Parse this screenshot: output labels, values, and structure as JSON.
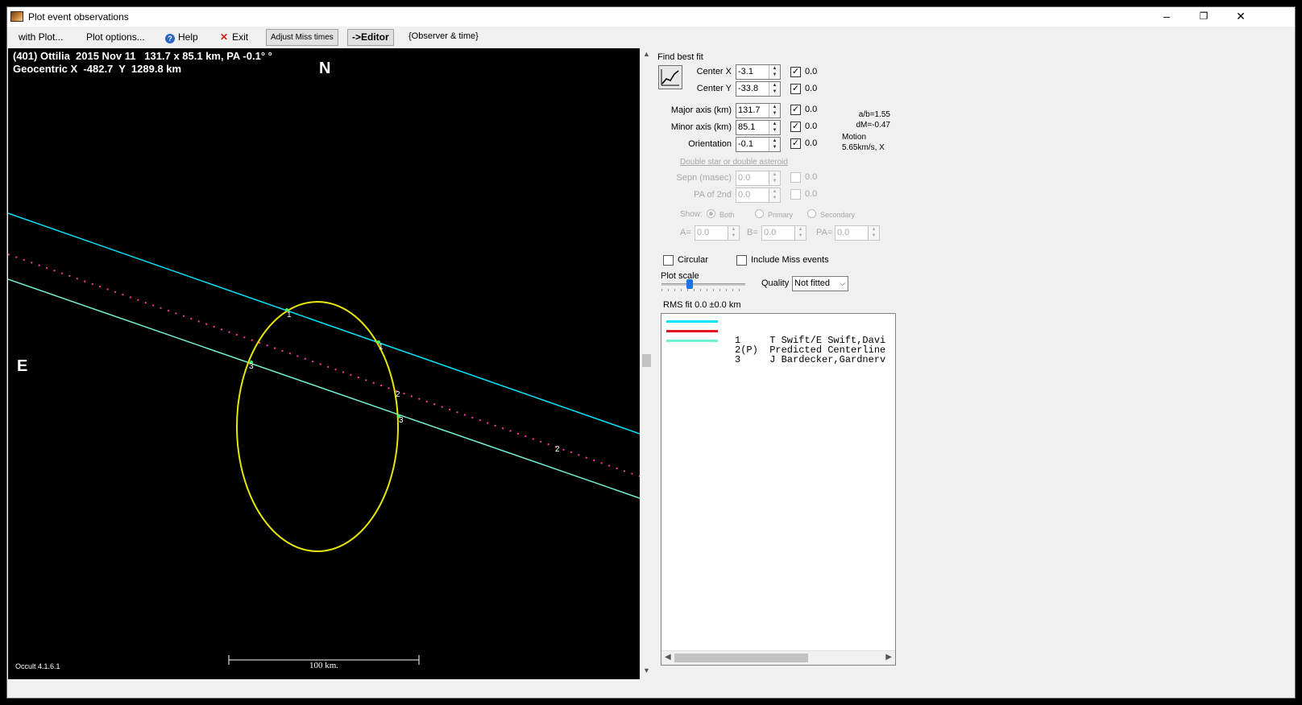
{
  "window": {
    "title": "Plot event observations",
    "min": "–",
    "restore": "❐",
    "close": "✕"
  },
  "menu": {
    "with_plot": "with Plot...",
    "plot_options": "Plot options...",
    "help": "Help",
    "exit": "Exit",
    "adjust_miss": "Adjust Miss times",
    "editor": "->Editor",
    "observer_time": "{Observer & time}"
  },
  "plot": {
    "header_line1": "(401) Ottilia  2015 Nov 11   131.7 x 85.1 km, PA -0.1° °",
    "header_line2": "Geocentric X  -482.7  Y  1289.8 km",
    "north": "N",
    "east": "E",
    "scale_label": "100 km.",
    "version": "Occult 4.1.6.1",
    "chord_labels": [
      "1",
      "1",
      "2",
      "2",
      "3",
      "3"
    ]
  },
  "panel": {
    "find_best_fit": "Find best fit",
    "center_x_label": "Center X",
    "center_x": "-3.1",
    "center_x_fit": "0.0",
    "center_y_label": "Center Y",
    "center_y": "-33.8",
    "center_y_fit": "0.0",
    "major_label": "Major axis (km)",
    "major": "131.7",
    "major_fit": "0.0",
    "minor_label": "Minor axis (km)",
    "minor": "85.1",
    "minor_fit": "0.0",
    "orient_label": "Orientation",
    "orient": "-0.1",
    "orient_fit": "0.0",
    "ab": "a/b=1.55",
    "dm": "dM=-0.47",
    "motion_label": "Motion",
    "motion": "5.65km/s, X",
    "double_link": "Double star  or  double asteroid",
    "sepn_label": "Sepn (masec)",
    "sepn": "0.0",
    "sepn_fit": "0.0",
    "pa2_label": "PA of 2nd",
    "pa2": "0.0",
    "pa2_fit": "0.0",
    "show_label": "Show:",
    "show_options": [
      "Both",
      "Primary",
      "Secondary"
    ],
    "a_label": "A=",
    "a_val": "0.0",
    "b_label": "B=",
    "b_val": "0.0",
    "pa_label": "PA=",
    "pa_val": "0.0",
    "circular": "Circular",
    "include_miss": "Include Miss events",
    "plot_scale": "Plot scale",
    "quality_label": "Quality",
    "quality": "Not fitted",
    "rms": "RMS fit 0.0 ±0.0 km"
  },
  "legend": [
    {
      "text": "1     T Swift/E Swift,Davi",
      "color": "#00e5ff"
    },
    {
      "text": "2(P)  Predicted Centerline",
      "color": "#e8101a"
    },
    {
      "text": "3     J Bardecker,Gardnerv",
      "color": "#70f0d0"
    }
  ]
}
